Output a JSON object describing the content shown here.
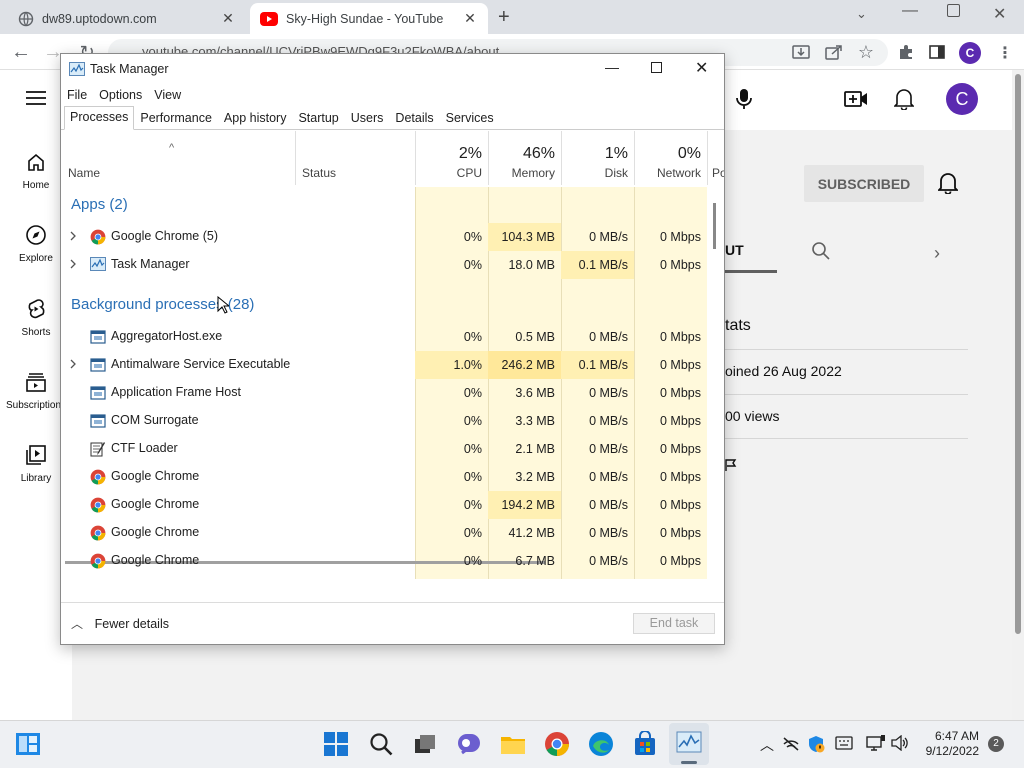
{
  "browser": {
    "tabs": [
      {
        "title": "dw89.uptodown.com",
        "active": false
      },
      {
        "title": "Sky-High Sundae - YouTube",
        "active": true
      }
    ],
    "url": "youtube.com/channel/UCVriPBw9EWDq9F3u2FkoWBA/about",
    "profile_initial": "C"
  },
  "youtube": {
    "sidebar": [
      {
        "label": "Home",
        "icon": "home-icon"
      },
      {
        "label": "Explore",
        "icon": "compass-icon"
      },
      {
        "label": "Shorts",
        "icon": "shorts-icon"
      },
      {
        "label": "Subscriptions",
        "icon": "subscriptions-icon"
      },
      {
        "label": "Library",
        "icon": "library-icon"
      }
    ],
    "profile_initial": "C",
    "subscribed_label": "SUBSCRIBED",
    "tab_partial": "UT",
    "stats_heading": "tats",
    "joined": "oined 26 Aug 2022",
    "views": "00 views"
  },
  "task_manager": {
    "title": "Task Manager",
    "menu": [
      "File",
      "Options",
      "View"
    ],
    "tabs": [
      "Processes",
      "Performance",
      "App history",
      "Startup",
      "Users",
      "Details",
      "Services"
    ],
    "active_tab": "Processes",
    "columns": {
      "name": "Name",
      "status": "Status",
      "cpu": {
        "pct": "2%",
        "label": "CPU"
      },
      "memory": {
        "pct": "46%",
        "label": "Memory"
      },
      "disk": {
        "pct": "1%",
        "label": "Disk"
      },
      "network": {
        "pct": "0%",
        "label": "Network"
      },
      "power": "Po"
    },
    "apps_group": "Apps (2)",
    "apps": [
      {
        "name": "Google Chrome (5)",
        "icon": "chrome-icon",
        "expand": true,
        "cpu": "0%",
        "memory": "104.3 MB",
        "disk": "0 MB/s",
        "network": "0 Mbps"
      },
      {
        "name": "Task Manager",
        "icon": "taskmanager-icon",
        "expand": true,
        "cpu": "0%",
        "memory": "18.0 MB",
        "disk": "0.1 MB/s",
        "network": "0 Mbps"
      }
    ],
    "bg_group": "Background processes (28)",
    "background": [
      {
        "name": "AggregatorHost.exe",
        "icon": "service-icon",
        "expand": false,
        "cpu": "0%",
        "memory": "0.5 MB",
        "disk": "0 MB/s",
        "network": "0 Mbps"
      },
      {
        "name": "Antimalware Service Executable",
        "icon": "service-icon",
        "expand": true,
        "cpu": "1.0%",
        "memory": "246.2 MB",
        "disk": "0.1 MB/s",
        "network": "0 Mbps"
      },
      {
        "name": "Application Frame Host",
        "icon": "service-icon",
        "expand": false,
        "cpu": "0%",
        "memory": "3.6 MB",
        "disk": "0 MB/s",
        "network": "0 Mbps"
      },
      {
        "name": "COM Surrogate",
        "icon": "service-icon",
        "expand": false,
        "cpu": "0%",
        "memory": "3.3 MB",
        "disk": "0 MB/s",
        "network": "0 Mbps"
      },
      {
        "name": "CTF Loader",
        "icon": "ctf-icon",
        "expand": false,
        "cpu": "0%",
        "memory": "2.1 MB",
        "disk": "0 MB/s",
        "network": "0 Mbps"
      },
      {
        "name": "Google Chrome",
        "icon": "chrome-icon",
        "expand": false,
        "cpu": "0%",
        "memory": "3.2 MB",
        "disk": "0 MB/s",
        "network": "0 Mbps"
      },
      {
        "name": "Google Chrome",
        "icon": "chrome-icon",
        "expand": false,
        "cpu": "0%",
        "memory": "194.2 MB",
        "disk": "0 MB/s",
        "network": "0 Mbps"
      },
      {
        "name": "Google Chrome",
        "icon": "chrome-icon",
        "expand": false,
        "cpu": "0%",
        "memory": "41.2 MB",
        "disk": "0 MB/s",
        "network": "0 Mbps"
      },
      {
        "name": "Google Chrome",
        "icon": "chrome-icon",
        "expand": false,
        "cpu": "0%",
        "memory": "6.7 MB",
        "disk": "0 MB/s",
        "network": "0 Mbps"
      }
    ],
    "fewer_details": "Fewer details",
    "end_task": "End task"
  },
  "taskbar": {
    "time": "6:47 AM",
    "date": "9/12/2022",
    "notifications": "2"
  },
  "colors": {
    "tm_col_light": "#fff9db",
    "tm_col_mid": "#fff0b3",
    "tm_col_hot": "#ffe89a",
    "group_blue": "#2a6fb5",
    "yt_avatar": "#5b2ab0"
  }
}
